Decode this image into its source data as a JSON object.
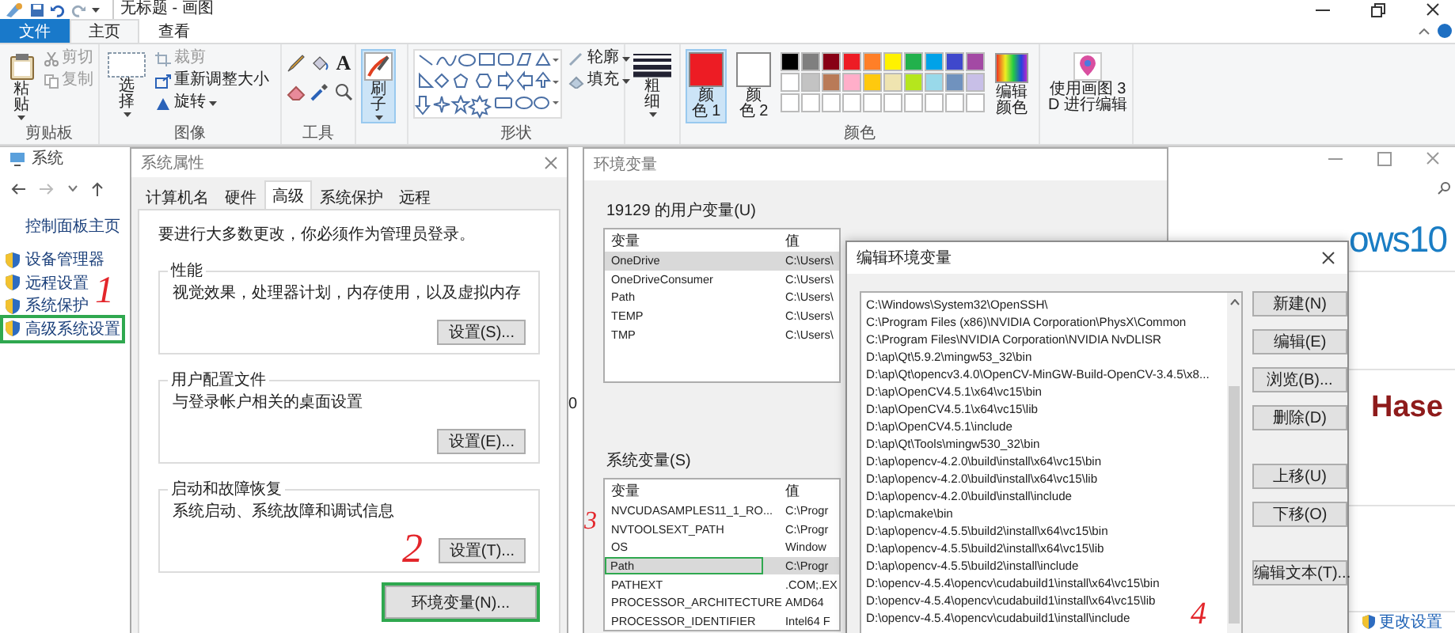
{
  "paint": {
    "title": "无标题 - 画图",
    "tabs": [
      {
        "label": "文件",
        "kind": "file",
        "selected": false
      },
      {
        "label": "主页",
        "kind": "tab",
        "selected": true
      },
      {
        "label": "查看",
        "kind": "tab",
        "selected": false
      }
    ],
    "clipboard": {
      "paste": "粘贴",
      "cut": {
        "label": "剪切",
        "disabled": true
      },
      "copy": {
        "label": "复制",
        "disabled": true
      },
      "label": "剪贴板"
    },
    "image": {
      "select": "选择",
      "crop": {
        "label": "裁剪",
        "disabled": true
      },
      "resize": "重新调整大小",
      "rotate": "旋转",
      "label": "图像"
    },
    "tools": {
      "text_tool": "A",
      "label": "工具"
    },
    "brush": {
      "label": "刷子",
      "selected": true
    },
    "shapes": {
      "outline": "轮廓",
      "fill": "填充",
      "label": "形状"
    },
    "size": {
      "label": "粗细"
    },
    "colors": {
      "label": "颜色",
      "slots": [
        {
          "label": "颜色 1",
          "color": "#ed1c24",
          "selected": true
        },
        {
          "label": "颜色 2",
          "color": "#ffffff",
          "selected": false
        }
      ],
      "palette": [
        {
          "color": "#000000"
        },
        {
          "color": "#7f7f7f"
        },
        {
          "color": "#880015"
        },
        {
          "color": "#ed1c24"
        },
        {
          "color": "#ff7f27"
        },
        {
          "color": "#fff200"
        },
        {
          "color": "#22b14c"
        },
        {
          "color": "#00a2e8"
        },
        {
          "color": "#3f48cc"
        },
        {
          "color": "#a349a4"
        },
        {
          "color": "#ffffff"
        },
        {
          "color": "#c3c3c3"
        },
        {
          "color": "#b97a57"
        },
        {
          "color": "#ffaec9"
        },
        {
          "color": "#ffc90e"
        },
        {
          "color": "#efe4b0"
        },
        {
          "color": "#b5e61d"
        },
        {
          "color": "#99d9ea"
        },
        {
          "color": "#7092be"
        },
        {
          "color": "#c8bfe7"
        }
      ],
      "edit": "编辑颜色"
    },
    "paint3d": "使用画图 3 D 进行编辑"
  },
  "system": {
    "title": "系统",
    "sidebar_title": "控制面板主页",
    "links": [
      {
        "label": "设备管理器",
        "highlighted": false
      },
      {
        "label": "远程设置",
        "highlighted": false
      },
      {
        "label": "系统保护",
        "highlighted": false
      },
      {
        "label": "高级系统设置",
        "highlighted": true
      }
    ],
    "partial_text": "0",
    "logo_text": "ows10",
    "brand": "Hase",
    "change_settings": "更改设置"
  },
  "system_properties": {
    "title": "系统属性",
    "tabs": [
      {
        "label": "计算机名",
        "selected": false
      },
      {
        "label": "硬件",
        "selected": false
      },
      {
        "label": "高级",
        "selected": true
      },
      {
        "label": "系统保护",
        "selected": false
      },
      {
        "label": "远程",
        "selected": false
      }
    ],
    "notice": "要进行大多数更改，你必须作为管理员登录。",
    "groups": [
      {
        "title": "性能",
        "description": "视觉效果，处理器计划，内存使用，以及虚拟内存",
        "button": "设置(S)..."
      },
      {
        "title": "用户配置文件",
        "description": "与登录帐户相关的桌面设置",
        "button": "设置(E)..."
      },
      {
        "title": "启动和故障恢复",
        "description": "系统启动、系统故障和调试信息",
        "button": "设置(T)..."
      }
    ],
    "env_button": "环境变量(N)...",
    "env_button_highlighted": true
  },
  "env_vars": {
    "title": "环境变量",
    "user_label": "19129 的用户变量(U)",
    "user_columns": [
      "变量",
      "值"
    ],
    "user_rows": [
      {
        "name": "OneDrive",
        "value": "C:\\Users\\",
        "selected": true
      },
      {
        "name": "OneDriveConsumer",
        "value": "C:\\Users\\",
        "selected": false
      },
      {
        "name": "Path",
        "value": "C:\\Users\\",
        "selected": false
      },
      {
        "name": "TEMP",
        "value": "C:\\Users\\",
        "selected": false
      },
      {
        "name": "TMP",
        "value": "C:\\Users\\",
        "selected": false
      }
    ],
    "system_label": "系统变量(S)",
    "system_columns": [
      "变量",
      "值"
    ],
    "system_rows": [
      {
        "name": "NVCUDASAMPLES11_1_RO...",
        "value": "C:\\Progr",
        "selected": false,
        "highlighted": false
      },
      {
        "name": "NVTOOLSEXT_PATH",
        "value": "C:\\Progr",
        "selected": false,
        "highlighted": false
      },
      {
        "name": "OS",
        "value": "Window",
        "selected": false,
        "highlighted": false
      },
      {
        "name": "Path",
        "value": "C:\\Progr",
        "selected": true,
        "highlighted": true
      },
      {
        "name": "PATHEXT",
        "value": ".COM;.EX",
        "selected": false,
        "highlighted": false
      },
      {
        "name": "PROCESSOR_ARCHITECTURE",
        "value": "AMD64",
        "selected": false,
        "highlighted": false
      },
      {
        "name": "PROCESSOR_IDENTIFIER",
        "value": "Intel64 F",
        "selected": false,
        "highlighted": false
      }
    ]
  },
  "edit_env": {
    "title": "编辑环境变量",
    "entries": [
      "C:\\Windows\\System32\\OpenSSH\\",
      "C:\\Program Files (x86)\\NVIDIA Corporation\\PhysX\\Common",
      "C:\\Program Files\\NVIDIA Corporation\\NVIDIA NvDLISR",
      "D:\\ap\\Qt\\5.9.2\\mingw53_32\\bin",
      "D:\\ap\\Qt\\opencv3.4.0\\OpenCV-MinGW-Build-OpenCV-3.4.5\\x8...",
      "D:\\ap\\OpenCV4.5.1\\x64\\vc15\\bin",
      "D:\\ap\\OpenCV4.5.1\\x64\\vc15\\lib",
      "D:\\ap\\OpenCV4.5.1\\include",
      "D:\\ap\\Qt\\Tools\\mingw530_32\\bin",
      "D:\\ap\\opencv-4.2.0\\build\\install\\x64\\vc15\\bin",
      "D:\\ap\\opencv-4.2.0\\build\\install\\x64\\vc15\\lib",
      "D:\\ap\\opencv-4.2.0\\build\\install\\include",
      "D:\\ap\\cmake\\bin",
      "D:\\ap\\opencv-4.5.5\\build2\\install\\x64\\vc15\\bin",
      "D:\\ap\\opencv-4.5.5\\build2\\install\\x64\\vc15\\lib",
      "D:\\ap\\opencv-4.5.5\\build2\\install\\include",
      "D:\\opencv-4.5.4\\opencv\\cudabuild1\\install\\x64\\vc15\\bin",
      "D:\\opencv-4.5.4\\opencv\\cudabuild1\\install\\x64\\vc15\\lib",
      "D:\\opencv-4.5.4\\opencv\\cudabuild1\\install\\include"
    ],
    "button_groups": [
      [
        "新建(N)",
        "编辑(E)",
        "浏览(B)...",
        "删除(D)"
      ],
      [
        "上移(U)",
        "下移(O)"
      ],
      [
        "编辑文本(T)..."
      ]
    ]
  },
  "annotations": [
    "1",
    "2",
    "3",
    "4"
  ]
}
